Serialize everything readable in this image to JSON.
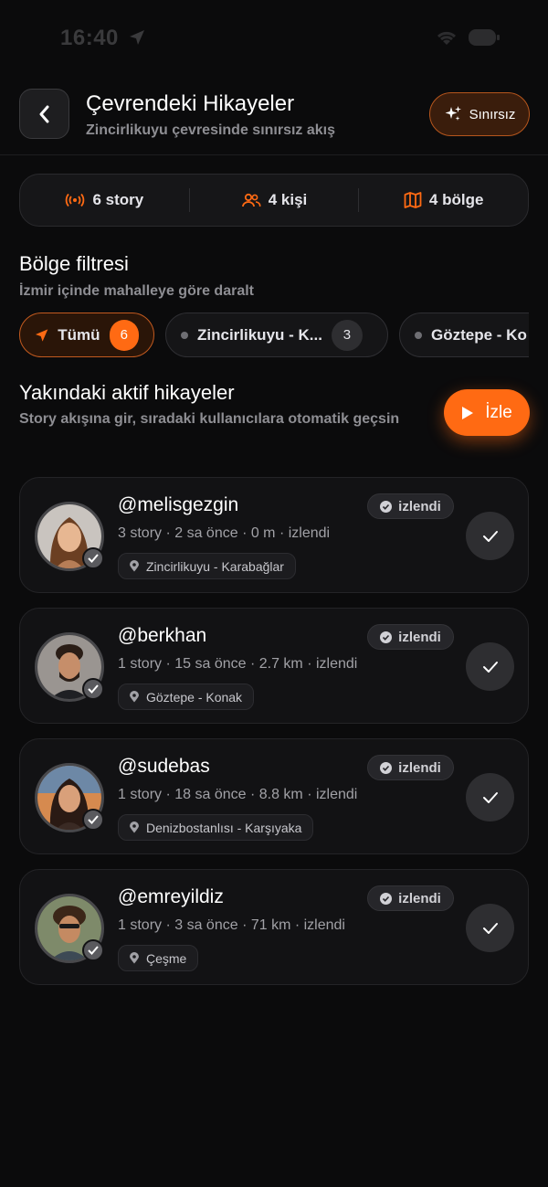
{
  "status_bar": {
    "time": "16:40"
  },
  "header": {
    "title": "Çevrendeki Hikayeler",
    "subtitle": "Zincirlikuyu çevresinde sınırsız akış",
    "unlimited_label": "Sınırsız"
  },
  "stats": [
    {
      "icon": "broadcast-icon",
      "label": "6 story"
    },
    {
      "icon": "users-icon",
      "label": "4 kişi"
    },
    {
      "icon": "map-icon",
      "label": "4 bölge"
    }
  ],
  "region_filter": {
    "title": "Bölge filtresi",
    "subtitle": "İzmir içinde mahalleye göre daralt",
    "chips": [
      {
        "label": "Tümü",
        "count": "6",
        "active": true
      },
      {
        "label": "Zincirlikuyu - K...",
        "count": "3",
        "active": false
      },
      {
        "label": "Göztepe - Ko",
        "count": "",
        "active": false
      }
    ]
  },
  "nearby": {
    "title": "Yakındaki aktif hikayeler",
    "subtitle": "Story akışına gir, sıradaki kullanıcılara otomatik geçsin",
    "watch_label": "İzle"
  },
  "stories": [
    {
      "username": "@melisgezgin",
      "meta": "3 story · 2 sa önce · 0 m · izlendi",
      "location": "Zincirlikuyu - Karabağlar",
      "badge": "izlendi"
    },
    {
      "username": "@berkhan",
      "meta": "1 story · 15 sa önce · 2.7 km · izlendi",
      "location": "Göztepe - Konak",
      "badge": "izlendi"
    },
    {
      "username": "@sudebas",
      "meta": "1 story · 18 sa önce · 8.8 km · izlendi",
      "location": "Denizbostanlısı - Karşıyaka",
      "badge": "izlendi"
    },
    {
      "username": "@emreyildiz",
      "meta": "1 story · 3 sa önce · 71 km · izlendi",
      "location": "Çeşme",
      "badge": "izlendi"
    }
  ],
  "colors": {
    "accent": "#ff6a13",
    "background": "#0b0b0c",
    "card": "#121214"
  }
}
